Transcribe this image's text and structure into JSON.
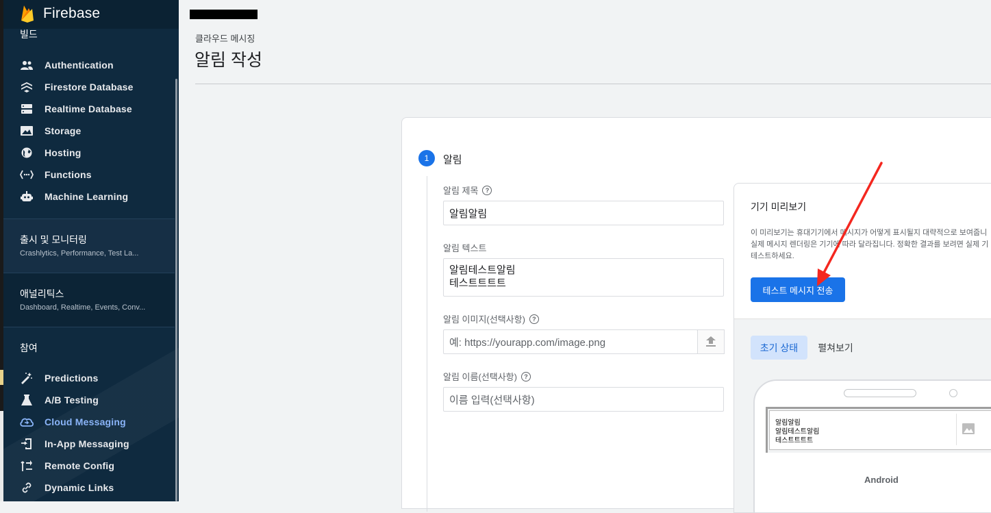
{
  "brand": {
    "name": "Firebase"
  },
  "sidebar": {
    "build_header": "빌드",
    "build_items": [
      {
        "label": "Authentication",
        "icon": "people-icon"
      },
      {
        "label": "Firestore Database",
        "icon": "firestore-icon"
      },
      {
        "label": "Realtime Database",
        "icon": "database-icon"
      },
      {
        "label": "Storage",
        "icon": "image-icon"
      },
      {
        "label": "Hosting",
        "icon": "globe-icon"
      },
      {
        "label": "Functions",
        "icon": "functions-icon"
      },
      {
        "label": "Machine Learning",
        "icon": "robot-icon"
      }
    ],
    "release": {
      "title": "출시 및 모니터링",
      "subtitle": "Crashlytics, Performance, Test La..."
    },
    "analytics": {
      "title": "애널리틱스",
      "subtitle": "Dashboard, Realtime, Events, Conv..."
    },
    "engage_header": "참여",
    "engage_items": [
      {
        "label": "Predictions",
        "icon": "wand-icon"
      },
      {
        "label": "A/B Testing",
        "icon": "flask-icon"
      },
      {
        "label": "Cloud Messaging",
        "icon": "cloud-messaging-icon",
        "active": true
      },
      {
        "label": "In-App Messaging",
        "icon": "in-app-icon"
      },
      {
        "label": "Remote Config",
        "icon": "remote-config-icon"
      },
      {
        "label": "Dynamic Links",
        "icon": "link-icon"
      }
    ]
  },
  "header": {
    "breadcrumb": "클라우드 메시징",
    "title": "알림 작성"
  },
  "form": {
    "step_number": "1",
    "step_title": "알림",
    "title_label": "알림 제목",
    "title_value": "알림알림",
    "text_label": "알림 텍스트",
    "text_line1": "알림테스트알림",
    "text_line2": "테스트트트트",
    "image_label": "알림 이미지(선택사항)",
    "image_placeholder": "예: https://yourapp.com/image.png",
    "name_label": "알림 이름(선택사항)",
    "name_placeholder": "이름 입력(선택사항)"
  },
  "preview": {
    "title": "기기 미리보기",
    "desc_line1": "이 미리보기는 휴대기기에서 메시지가 어떻게 표시될지 대략적으로 보여줍니",
    "desc_line2": "실제 메시지 렌더링은 기기에 따라 달라집니다. 정확한 결과를 보려면 실제 기",
    "desc_line3": "테스트하세요.",
    "send_button": "테스트 메시지 전송",
    "tab_initial": "초기 상태",
    "tab_expanded": "펼쳐보기",
    "notif_title": "알림알림",
    "notif_text1": "알림테스트알림",
    "notif_text2": "테스트트트트",
    "platform": "Android"
  },
  "colors": {
    "accent": "#1a73e8",
    "sidebar_bg": "#0f2a3f",
    "active_nav": "#8ab4f8",
    "annotation_arrow": "#f4271f"
  }
}
